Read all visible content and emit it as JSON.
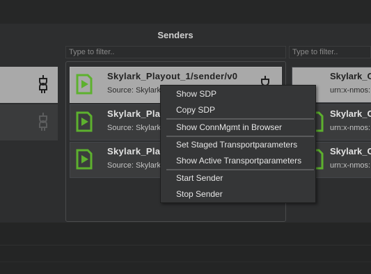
{
  "header": {
    "section_title": "Senders"
  },
  "filters": {
    "placeholder": "Type to filter.."
  },
  "senders": [
    {
      "name": "Skylark_Playout_1/sender/v0",
      "source": "Source: Skylark",
      "selected": true
    },
    {
      "name": "Skylark_Play",
      "source": "Source: Skylark",
      "selected": false
    },
    {
      "name": "Skylark_Play",
      "source": "Source: Skylark",
      "selected": false
    }
  ],
  "right_items": [
    {
      "name": "Skylark_C",
      "source": "urn:x-nmos:"
    },
    {
      "name": "Skylark_C",
      "source": "urn:x-nmos:"
    },
    {
      "name": "Skylark_C",
      "source": "urn:x-nmos:"
    }
  ],
  "context_menu": {
    "items": [
      "Show SDP",
      "Copy SDP",
      "Show ConnMgmt in Browser",
      "Set Staged Transportparameters",
      "Show Active Transportparameters",
      "Start Sender",
      "Stop Sender"
    ]
  },
  "colors": {
    "accent_green": "#5db12e",
    "selected_card": "#a9a9a9"
  },
  "icons": {
    "sender": "video-sender-icon",
    "plug": "plug-icon"
  }
}
